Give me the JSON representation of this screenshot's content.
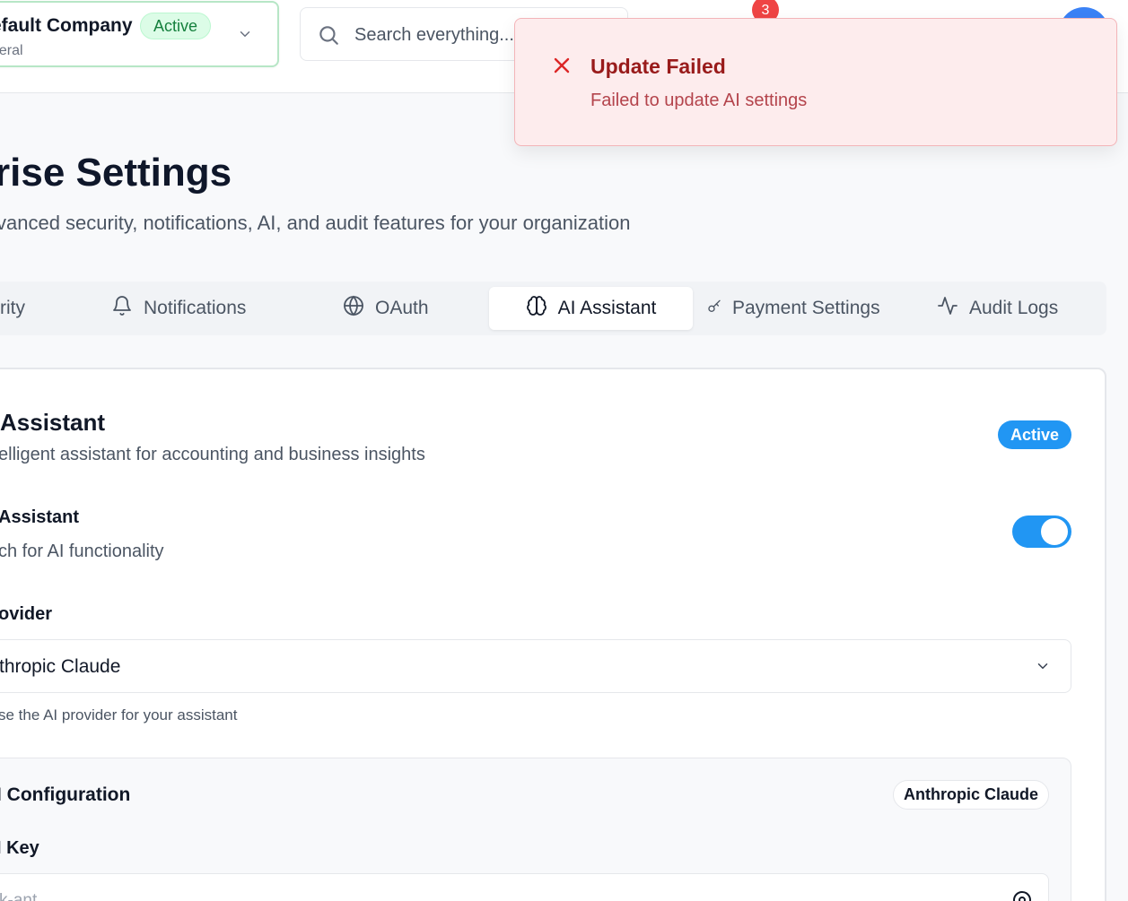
{
  "header": {
    "company": {
      "name": "efault Company",
      "status": "Active",
      "subtitle": "neral"
    },
    "search": {
      "placeholder": "Search everything..."
    },
    "notifications": {
      "count": "3"
    }
  },
  "page": {
    "title": "rise Settings",
    "subtitle": "vanced security, notifications, AI, and audit features for your organization"
  },
  "tabs": [
    {
      "label": "rity",
      "icon": "shield-icon"
    },
    {
      "label": "Notifications",
      "icon": "bell-icon"
    },
    {
      "label": "OAuth",
      "icon": "globe-icon"
    },
    {
      "label": "AI Assistant",
      "icon": "brain-icon",
      "active": true
    },
    {
      "label": "Payment Settings",
      "icon": "key-icon"
    },
    {
      "label": "Audit Logs",
      "icon": "activity-icon"
    }
  ],
  "ai_card": {
    "title": "Assistant",
    "description": "elligent assistant for accounting and business insights",
    "status": "Active",
    "enable": {
      "label": "Assistant",
      "help": "ch for AI functionality",
      "enabled": true
    },
    "provider": {
      "label": "ovider",
      "value": "thropic Claude",
      "help": "se the AI provider for your assistant"
    },
    "api": {
      "title": "I Configuration",
      "provider_chip": "Anthropic Claude",
      "key_label": "I Key",
      "key_placeholder": "k-ant..."
    }
  },
  "toast": {
    "title": "Update Failed",
    "message": "Failed to update AI settings"
  },
  "colors": {
    "primary": "#2196f3",
    "success_bg": "#dcfce7",
    "error_bg": "#fdeced",
    "error_text": "#991b1b",
    "notification": "#ef4444"
  }
}
